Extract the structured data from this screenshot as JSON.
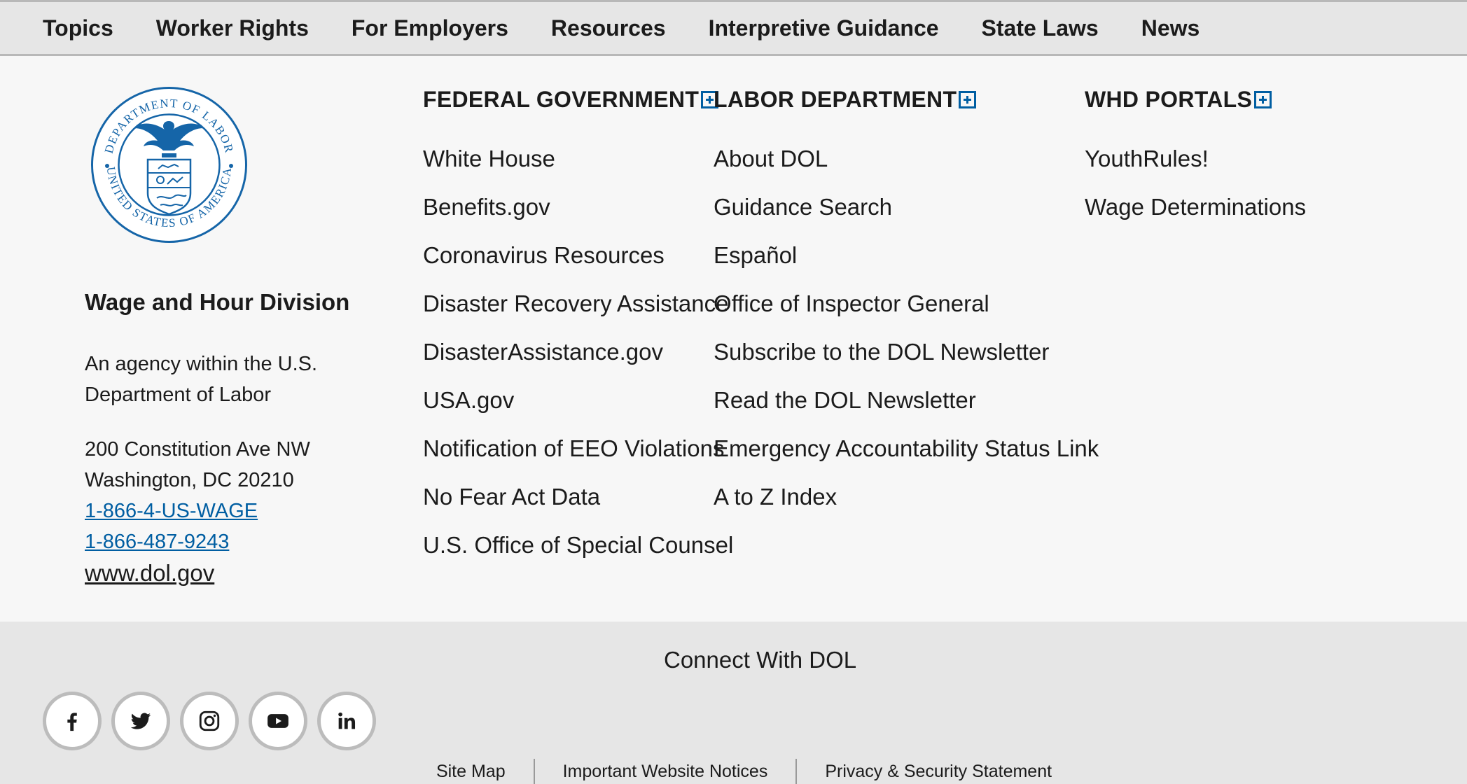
{
  "topnav": {
    "items": [
      "Topics",
      "Worker Rights",
      "For Employers",
      "Resources",
      "Interpretive Guidance",
      "State Laws",
      "News"
    ]
  },
  "agency": {
    "name": "Wage and Hour Division",
    "description": "An agency within the U.S. Department of Labor",
    "address_line1": "200 Constitution Ave NW",
    "address_line2": "Washington, DC 20210",
    "phone1": "1-866-4-US-WAGE",
    "phone2": "1-866-487-9243",
    "website": "www.dol.gov",
    "seal_top_text": "DEPARTMENT OF LABOR",
    "seal_bottom_text": "UNITED STATES OF AMERICA"
  },
  "columns": {
    "federal": {
      "heading": "FEDERAL GOVERNMENT",
      "links": [
        "White House",
        "Benefits.gov",
        "Coronavirus Resources",
        "Disaster Recovery Assistance",
        "DisasterAssistance.gov",
        "USA.gov",
        "Notification of EEO Violations",
        "No Fear Act Data",
        "U.S. Office of Special Counsel"
      ]
    },
    "labor": {
      "heading": "LABOR DEPARTMENT",
      "links": [
        "About DOL",
        "Guidance Search",
        "Español",
        "Office of Inspector General",
        "Subscribe to the DOL Newsletter",
        "Read the DOL Newsletter",
        "Emergency Accountability Status Link",
        "A to Z Index"
      ]
    },
    "whd": {
      "heading": "WHD PORTALS",
      "links": [
        "YouthRules!",
        "Wage Determinations"
      ]
    }
  },
  "footer": {
    "connect": "Connect With DOL",
    "social": [
      "facebook-icon",
      "twitter-icon",
      "instagram-icon",
      "youtube-icon",
      "linkedin-icon"
    ],
    "legal": [
      "Site Map",
      "Important Website Notices",
      "Privacy & Security Statement"
    ]
  },
  "colors": {
    "link_blue": "#005ea2",
    "nav_bg": "#e6e6e6",
    "page_bg": "#f7f7f7"
  }
}
